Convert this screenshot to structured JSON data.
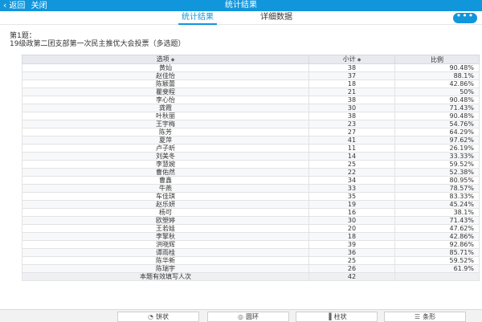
{
  "topbar": {
    "back_label": "返回",
    "close_label": "关闭",
    "title": "统计结果"
  },
  "tabs": [
    {
      "label": "统计结果",
      "active": true
    },
    {
      "label": "详细数据",
      "active": false
    }
  ],
  "more_label": "•••",
  "question": "第1题：\n19级政第二团支部第一次民主推优大会投票（多选题）",
  "table": {
    "headers": [
      "选项",
      "小计",
      "比例"
    ],
    "rows": [
      [
        "黄灿",
        "38",
        "90.48%"
      ],
      [
        "赵佳怡",
        "37",
        "88.1%"
      ],
      [
        "陈颖蕾",
        "18",
        "42.86%"
      ],
      [
        "瞿斐程",
        "21",
        "50%"
      ],
      [
        "李心怡",
        "38",
        "90.48%"
      ],
      [
        "龚霞",
        "30",
        "71.43%"
      ],
      [
        "叶秋丽",
        "38",
        "90.48%"
      ],
      [
        "王宇梅",
        "23",
        "54.76%"
      ],
      [
        "陈芳",
        "27",
        "64.29%"
      ],
      [
        "夏萍",
        "41",
        "97.62%"
      ],
      [
        "卢子昕",
        "11",
        "26.19%"
      ],
      [
        "刘美冬",
        "14",
        "33.33%"
      ],
      [
        "李慧婉",
        "25",
        "59.52%"
      ],
      [
        "曹佑然",
        "22",
        "52.38%"
      ],
      [
        "曹鑫",
        "34",
        "80.95%"
      ],
      [
        "牛燕",
        "33",
        "78.57%"
      ],
      [
        "车佳琪",
        "35",
        "83.33%"
      ],
      [
        "赵乐妍",
        "19",
        "45.24%"
      ],
      [
        "杨可",
        "16",
        "38.1%"
      ],
      [
        "欧塑婷",
        "30",
        "71.43%"
      ],
      [
        "王若娃",
        "20",
        "47.62%"
      ],
      [
        "李擎秋",
        "18",
        "42.86%"
      ],
      [
        "洪晓辉",
        "39",
        "92.86%"
      ],
      [
        "谭雨桂",
        "36",
        "85.71%"
      ],
      [
        "陈华新",
        "25",
        "59.52%"
      ],
      [
        "陈瑞宇",
        "26",
        "61.9%"
      ]
    ],
    "total_label": "本题有效填写人次",
    "total_value": "42"
  },
  "bottombar": {
    "buttons": [
      {
        "label": "饼状",
        "icon": "pie-icon"
      },
      {
        "label": "圆环",
        "icon": "ring-icon"
      },
      {
        "label": "柱状",
        "icon": "bar-chart-icon"
      },
      {
        "label": "条形",
        "icon": "list-bar-icon"
      }
    ]
  },
  "colors": {
    "accent": "#1296db",
    "header_bg": "#e8eaef"
  }
}
